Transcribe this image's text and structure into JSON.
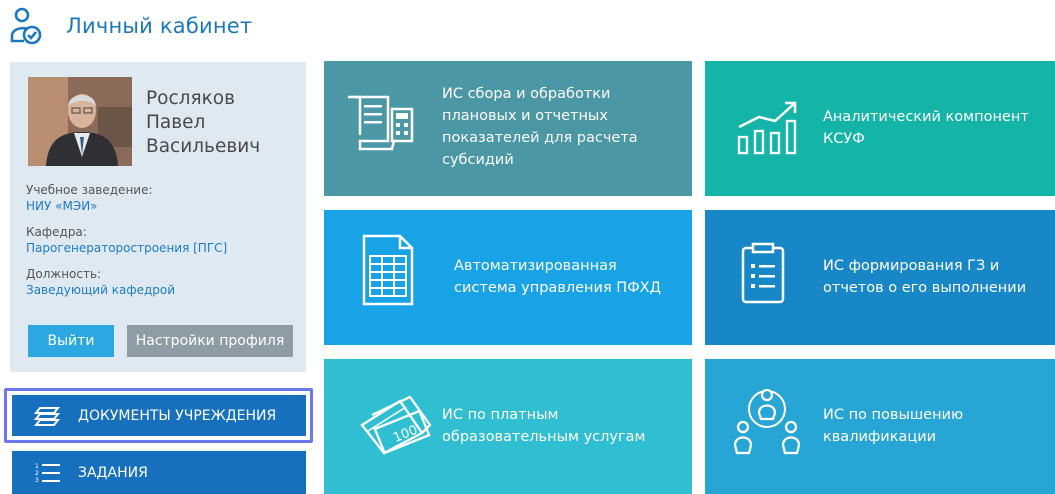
{
  "header": {
    "title": "Личный кабинет",
    "icon": "user-check-icon"
  },
  "profile": {
    "name_lines": [
      "Росляков",
      "Павел",
      "Васильевич"
    ],
    "institution_label": "Учебное заведение:",
    "institution_value": "НИУ «МЭИ»",
    "department_label": "Кафедра:",
    "department_value": "Парогенераторостроения [ПГС]",
    "position_label": "Должность:",
    "position_value": "Заведующий кафедрой",
    "logout_label": "Выйти",
    "settings_label": "Настройки профиля"
  },
  "nav": {
    "items": [
      {
        "label": "ДОКУМЕНТЫ УЧРЕЖДЕНИЯ",
        "icon": "stack-icon",
        "highlighted": true
      },
      {
        "label": "ЗАДАНИЯ",
        "icon": "numbered-list-icon",
        "highlighted": false
      }
    ]
  },
  "tiles": [
    {
      "lines": [
        "ИС сбора и обработки",
        "плановых и отчетных",
        "показателей для расчета",
        "субсидий"
      ],
      "icon": "receipt-calculator-icon",
      "color": "#4b97a6"
    },
    {
      "lines": [
        "Аналитический компонент",
        "КСУФ"
      ],
      "icon": "growth-chart-icon",
      "color": "#14b5a8"
    },
    {
      "lines": [
        "Автоматизированная",
        "система управления ПФХД"
      ],
      "icon": "spreadsheet-icon",
      "color": "#17a3e6"
    },
    {
      "lines": [
        "ИС формирования ГЗ и",
        "отчетов о его выполнении"
      ],
      "icon": "clipboard-list-icon",
      "color": "#1787c7"
    },
    {
      "lines": [
        "ИС по платным",
        "образовательным услугам"
      ],
      "icon": "money-icon",
      "color": "#30bfd2"
    },
    {
      "lines": [
        "ИС  по повышению",
        "квалификации"
      ],
      "icon": "people-network-icon",
      "color": "#27a5d4"
    }
  ],
  "banknote_text": "100"
}
